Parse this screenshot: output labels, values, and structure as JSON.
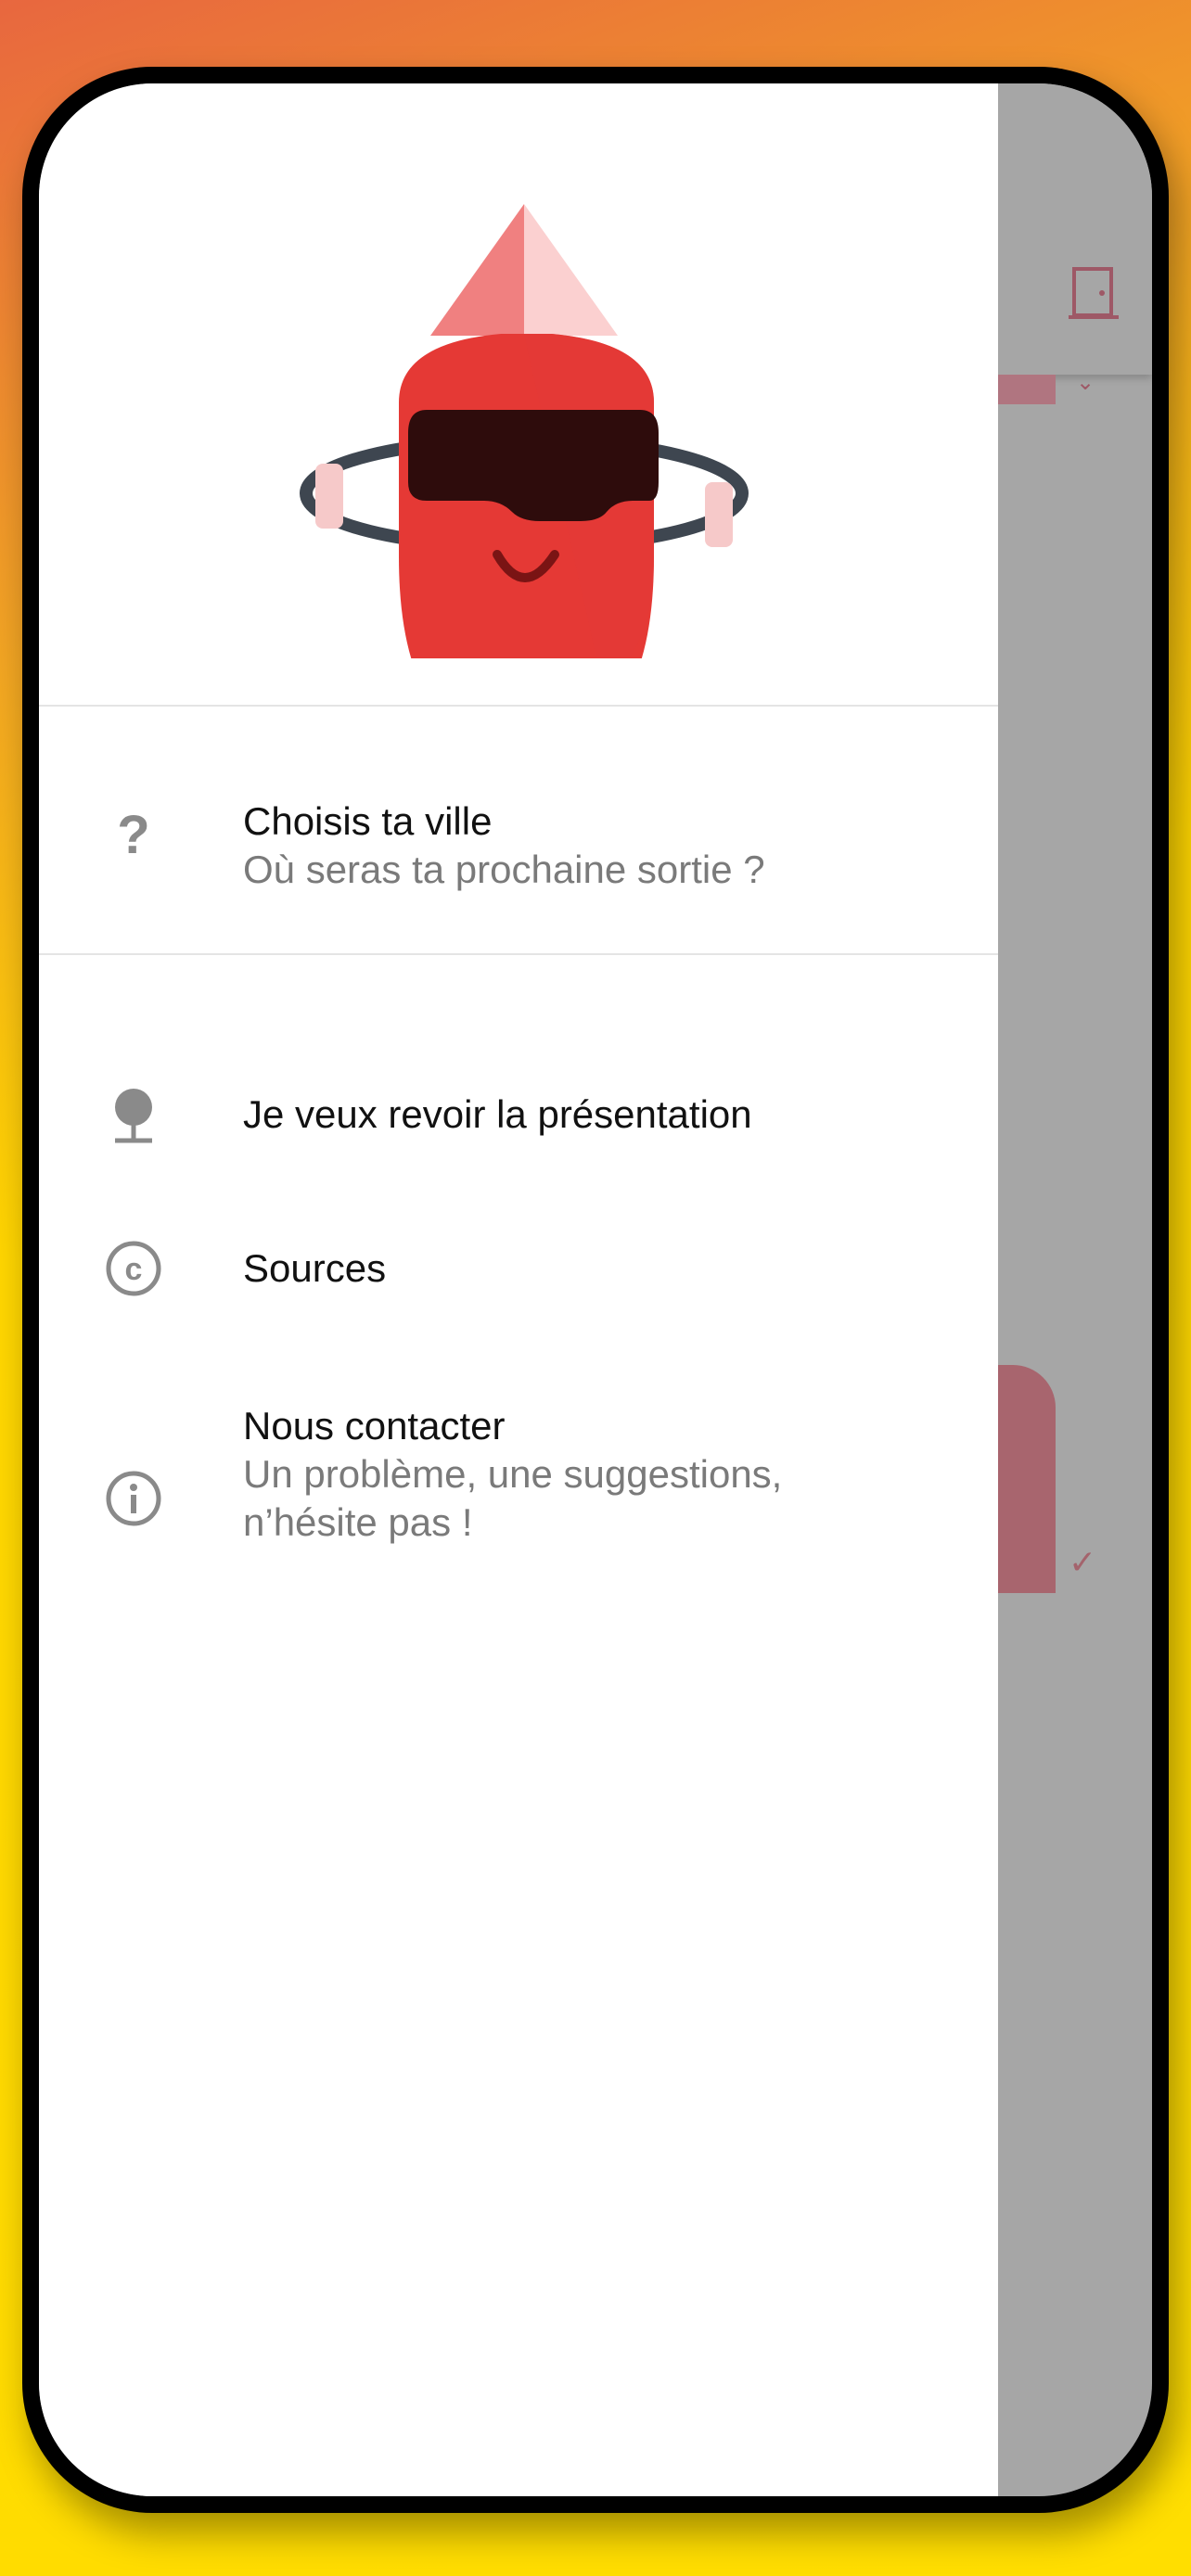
{
  "drawer": {
    "items": [
      {
        "title": "Choisis ta ville",
        "subtitle": "Où seras ta prochaine sortie ?",
        "icon": "question-mark-icon"
      },
      {
        "title": "Je veux revoir la présentation",
        "icon": "presentation-icon"
      },
      {
        "title": "Sources",
        "icon": "copyright-icon"
      },
      {
        "title": "Nous contacter",
        "subtitle_line1": "Un problème, une suggestions,",
        "subtitle_line2": "n’hésite pas !",
        "icon": "info-icon"
      }
    ]
  },
  "background_app": {
    "icons": [
      "door-icon",
      "check-icon"
    ]
  },
  "colors": {
    "background_gradient_start": "#E8673F",
    "background_gradient_end": "#FFDE00",
    "mascot_red": "#E53935",
    "icon_gray": "#8A8A8A",
    "scrim": "#A6A6A6"
  }
}
